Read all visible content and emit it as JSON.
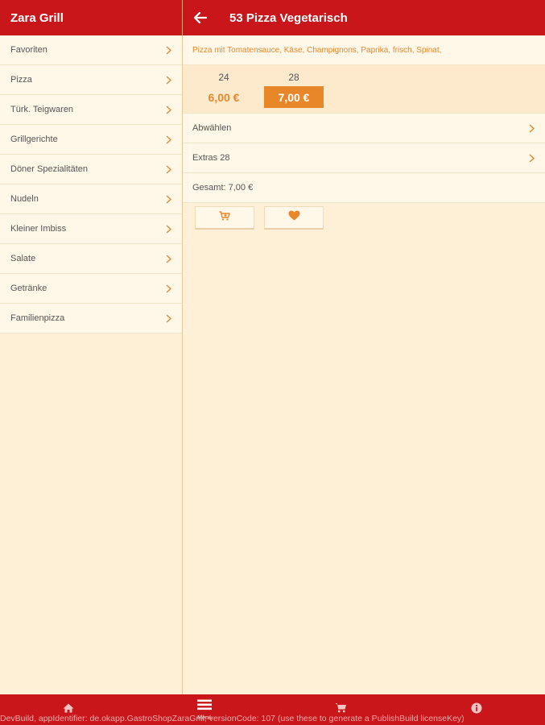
{
  "left_header": {
    "title": "Zara Grill"
  },
  "right_header": {
    "title": "53 Pizza Vegetarisch"
  },
  "sidebar": {
    "items": [
      {
        "label": "Favoriten"
      },
      {
        "label": "Pizza"
      },
      {
        "label": "Türk. Teigwaren"
      },
      {
        "label": "Grillgerichte"
      },
      {
        "label": "Döner Spezialitäten"
      },
      {
        "label": "Nudeln"
      },
      {
        "label": "Kleiner Imbiss"
      },
      {
        "label": "Salate"
      },
      {
        "label": "Getränke"
      },
      {
        "label": "Familienpizza"
      }
    ]
  },
  "product": {
    "description": "Pizza mit Tomatensauce, Käse, Champignons, Paprika, frisch, Spinat,",
    "sizes": [
      {
        "label": "24",
        "price": "6,00 €",
        "selected": false
      },
      {
        "label": "28",
        "price": "7,00 €",
        "selected": true
      }
    ],
    "deselect_label": "Abwählen",
    "extras_label": "Extras 28",
    "total_label": "Gesamt: 7,00 €"
  },
  "bottom_nav": {
    "menu_label": "Menü",
    "tabs": [
      {
        "icon": "home-icon"
      },
      {
        "icon": "menu-list-icon"
      },
      {
        "icon": "cart-icon"
      },
      {
        "icon": "info-icon"
      }
    ]
  },
  "dev_notice": "DevBuild, appIdentifier: de.okapp.GastroShopZaraGrill, versionCode: 107 (use these to generate a PublishBuild licenseKey)",
  "colors": {
    "header_red": "#c8161a",
    "accent_orange": "#e8872a",
    "background_cream": "#fdf0d6"
  }
}
